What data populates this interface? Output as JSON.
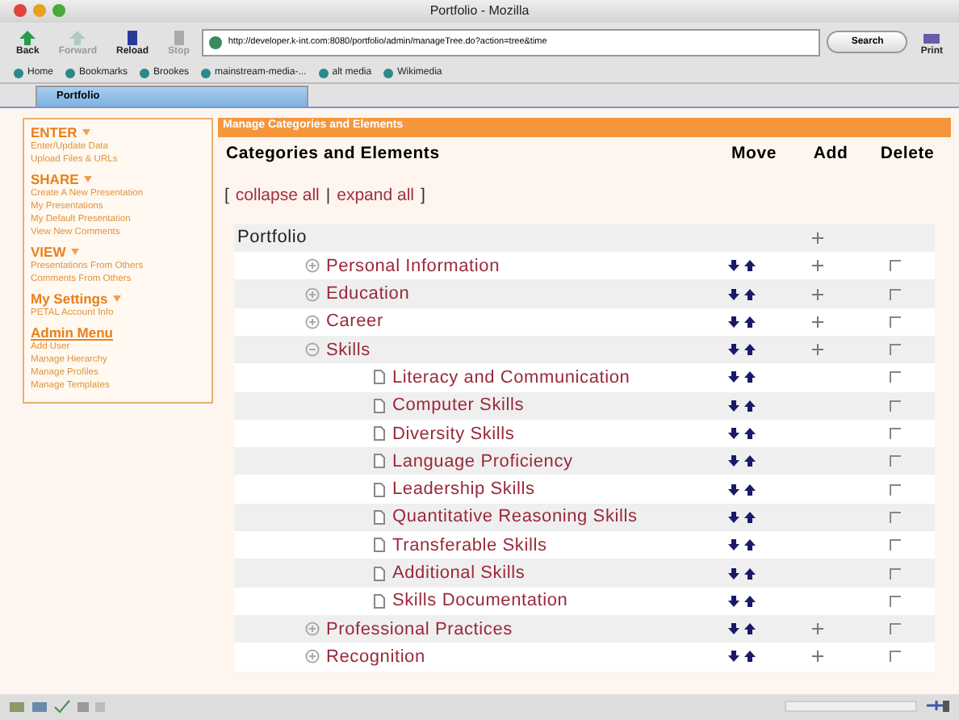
{
  "window": {
    "title": "Portfolio - Mozilla"
  },
  "toolbar": {
    "buttons": [
      {
        "label": "Back",
        "disabled": false,
        "kind": "back"
      },
      {
        "label": "Forward",
        "disabled": true,
        "kind": "forward"
      },
      {
        "label": "Reload",
        "disabled": false,
        "kind": "reload"
      },
      {
        "label": "Stop",
        "disabled": true,
        "kind": "stop"
      }
    ],
    "url": "http://developer.k-int.com:8080/portfolio/admin/manageTree.do?action=tree&time",
    "search": "Search",
    "print": "Print"
  },
  "bookmarks": [
    "Home",
    "Bookmarks",
    "Brookes",
    "mainstream-media-...",
    "alt media",
    "Wikimedia"
  ],
  "tabs": [
    {
      "label": "Portfolio",
      "selected": true
    }
  ],
  "sidebar": [
    {
      "heading": "ENTER",
      "kind": "collapsible",
      "items": [
        "Enter/Update Data",
        "Upload Files & URLs"
      ]
    },
    {
      "heading": "SHARE",
      "kind": "collapsible",
      "items": [
        "Create A New Presentation",
        "My Presentations",
        "My Default Presentation",
        "View New Comments"
      ]
    },
    {
      "heading": "VIEW",
      "kind": "collapsible",
      "items": [
        "Presentations From Others",
        "Comments From Others"
      ]
    },
    {
      "heading": "My Settings",
      "kind": "collapsible",
      "items": [
        "PETAL Account Info"
      ]
    },
    {
      "heading": "Admin Menu",
      "kind": "link",
      "items": [
        "Add User",
        "Manage Hierarchy",
        "Manage Profiles",
        "Manage Templates"
      ]
    }
  ],
  "panel": {
    "title": "Manage Categories and Elements",
    "columns": [
      "Categories and Elements",
      "Move",
      "Add",
      "Delete"
    ],
    "links": [
      {
        "text": "[",
        "kind": "bracket"
      },
      {
        "text": "collapse all",
        "kind": "link"
      },
      {
        "text": "|",
        "kind": "separator"
      },
      {
        "text": "expand all",
        "kind": "link"
      },
      {
        "text": "]",
        "kind": "bracket"
      }
    ],
    "tree": {
      "name": "Portfolio",
      "kind": "root",
      "children": [
        {
          "name": "Personal Information",
          "kind": "category",
          "expanded": false,
          "checked": false
        },
        {
          "name": "Education",
          "kind": "category",
          "expanded": false,
          "checked": false
        },
        {
          "name": "Career",
          "kind": "category",
          "expanded": false,
          "checked": false
        },
        {
          "name": "Skills",
          "kind": "category",
          "expanded": true,
          "checked": false,
          "children": [
            {
              "name": "Literacy and Communication",
              "kind": "element",
              "checked": false
            },
            {
              "name": "Computer Skills",
              "kind": "element",
              "checked": false
            },
            {
              "name": "Diversity Skills",
              "kind": "element",
              "checked": false
            },
            {
              "name": "Language Proficiency",
              "kind": "element",
              "checked": false
            },
            {
              "name": "Leadership Skills",
              "kind": "element",
              "checked": false
            },
            {
              "name": "Quantitative Reasoning Skills",
              "kind": "element",
              "checked": false
            },
            {
              "name": "Transferable Skills",
              "kind": "element",
              "checked": false
            },
            {
              "name": "Additional Skills",
              "kind": "element",
              "checked": false
            },
            {
              "name": "Skills Documentation",
              "kind": "element",
              "checked": false
            }
          ]
        },
        {
          "name": "Professional Practices",
          "kind": "category",
          "expanded": false,
          "checked": false
        },
        {
          "name": "Recognition",
          "kind": "category",
          "expanded": false,
          "checked": false
        }
      ]
    }
  }
}
